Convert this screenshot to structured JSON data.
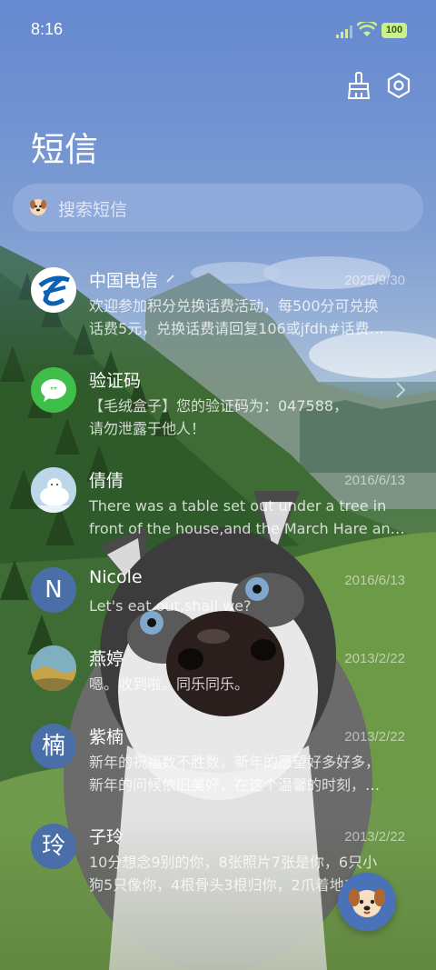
{
  "status_bar": {
    "time": "8:16",
    "battery": "100"
  },
  "header": {
    "title": "短信"
  },
  "search": {
    "placeholder": "搜索短信"
  },
  "conversations": [
    {
      "name": "中国电信",
      "date": "2025/9/30",
      "lines": [
        "欢迎参加积分兑换话费活动，每500分可兑换",
        "话费5元，兑换话费请回复106或jfdh#话费…"
      ],
      "avatar_icon": "china-telecom-logo-icon",
      "avatar_color": "#0a62b3"
    },
    {
      "name": "验证码",
      "date": "",
      "lines": [
        "【毛绒盒子】您的验证码为：047588，",
        "请勿泄露于他人！"
      ],
      "avatar_icon": "message-bubble-icon",
      "avatar_color": "#3fbf4a"
    },
    {
      "name": "倩倩",
      "date": "2016/6/13",
      "lines": [
        "There was a table set out under a tree in",
        "front of the house,and the March Hare an…"
      ],
      "avatar_icon": "polar-bear-photo",
      "avatar_color": "#cfe0ee"
    },
    {
      "name": "Nicole",
      "date": "2016/6/13",
      "lines": [
        "Let's eat out,shall we?"
      ],
      "avatar_letter": "N",
      "avatar_color": "#4a6fa8"
    },
    {
      "name": "燕婷",
      "date": "2013/2/22",
      "lines": [
        "嗯。收到啦。同乐同乐。"
      ],
      "avatar_icon": "landscape-photo",
      "avatar_color": "#8aa36a"
    },
    {
      "name": "紫楠",
      "date": "2013/2/22",
      "lines": [
        "新年的祝福数不胜数，新年的愿望好多好多，",
        "新年的问候依旧美好，在这个温馨的时刻，…"
      ],
      "avatar_letter": "楠",
      "avatar_color": "#4a6fa8"
    },
    {
      "name": "子玲",
      "date": "2013/2/22",
      "lines": [
        "10分想念9别的你，8张照片7张是你，6只小",
        "狗5只像你，4根骨头3根归你，2爪着地1定…"
      ],
      "avatar_letter": "玲",
      "avatar_color": "#4a6fa8"
    }
  ],
  "fab": {
    "icon": "dog-face-icon"
  }
}
